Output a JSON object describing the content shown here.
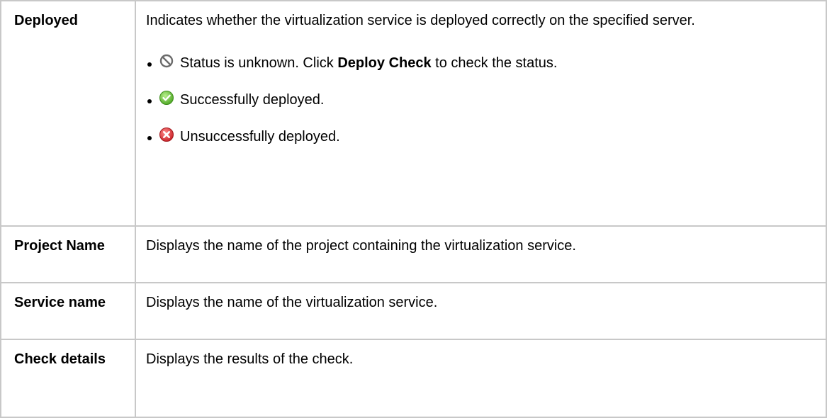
{
  "rows": [
    {
      "term": "Deployed",
      "description": "Indicates whether the virtualization service is deployed correctly on the specified server.",
      "statuses": [
        {
          "icon": "unknown-status-icon",
          "text_before": "Status is unknown. Click ",
          "bold": "Deploy Check",
          "text_after": " to check the status."
        },
        {
          "icon": "success-check-icon",
          "text": "Successfully deployed."
        },
        {
          "icon": "error-x-icon",
          "text": "Unsuccessfully deployed."
        }
      ]
    },
    {
      "term": "Project Name",
      "description": "Displays the name of the project containing the virtualization service."
    },
    {
      "term": "Service name",
      "description": "Displays the name of the virtualization service."
    },
    {
      "term": "Check details",
      "description": "Displays the results of the check."
    }
  ],
  "colors": {
    "border": "#c8c8c8",
    "success": "#5cb82e",
    "error": "#d8232a",
    "unknown": "#6b6b6b"
  }
}
